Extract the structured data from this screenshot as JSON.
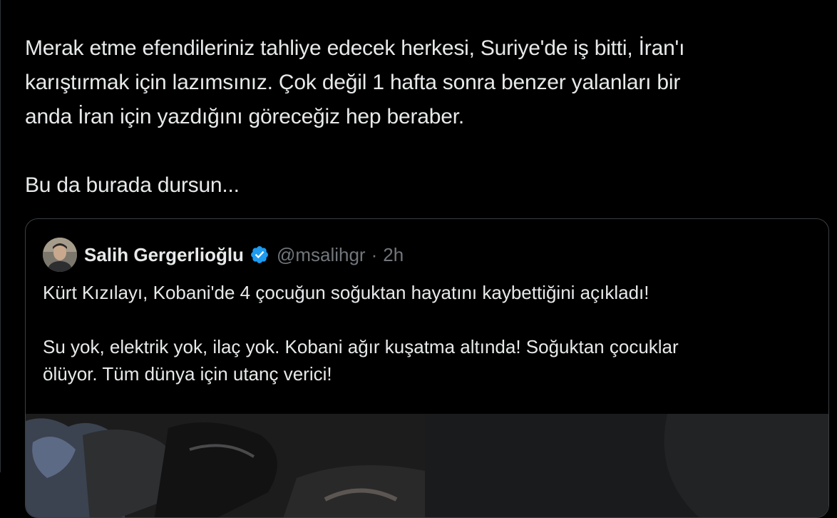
{
  "tweet": {
    "lines": [
      "Merak etme efendileriniz tahliye edecek herkesi, Suriye'de iş bitti, İran'ı",
      "karıştırmak için lazımsınız. Çok değil 1 hafta sonra benzer yalanları bir",
      "anda İran için yazdığını göreceğiz hep beraber.",
      "Bu da burada dursun..."
    ]
  },
  "quote": {
    "author_name": "Salih Gergerlioğlu",
    "handle": "@msalihgr",
    "separator": "·",
    "time": "2h",
    "verified_icon": "verified-badge-icon",
    "lines": [
      "Kürt Kızılayı, Kobani'de 4 çocuğun soğuktan hayatını kaybettiğini açıkladı!",
      "Su yok, elektrik yok, ilaç yok. Kobani ağır kuşatma altında! Soğuktan çocuklar",
      "ölüyor. Tüm dünya için utanç verici!"
    ]
  },
  "colors": {
    "background": "#000000",
    "text": "#e7e9ea",
    "muted": "#71767b",
    "verified": "#1d9bf0",
    "border": "#3a3f44"
  }
}
